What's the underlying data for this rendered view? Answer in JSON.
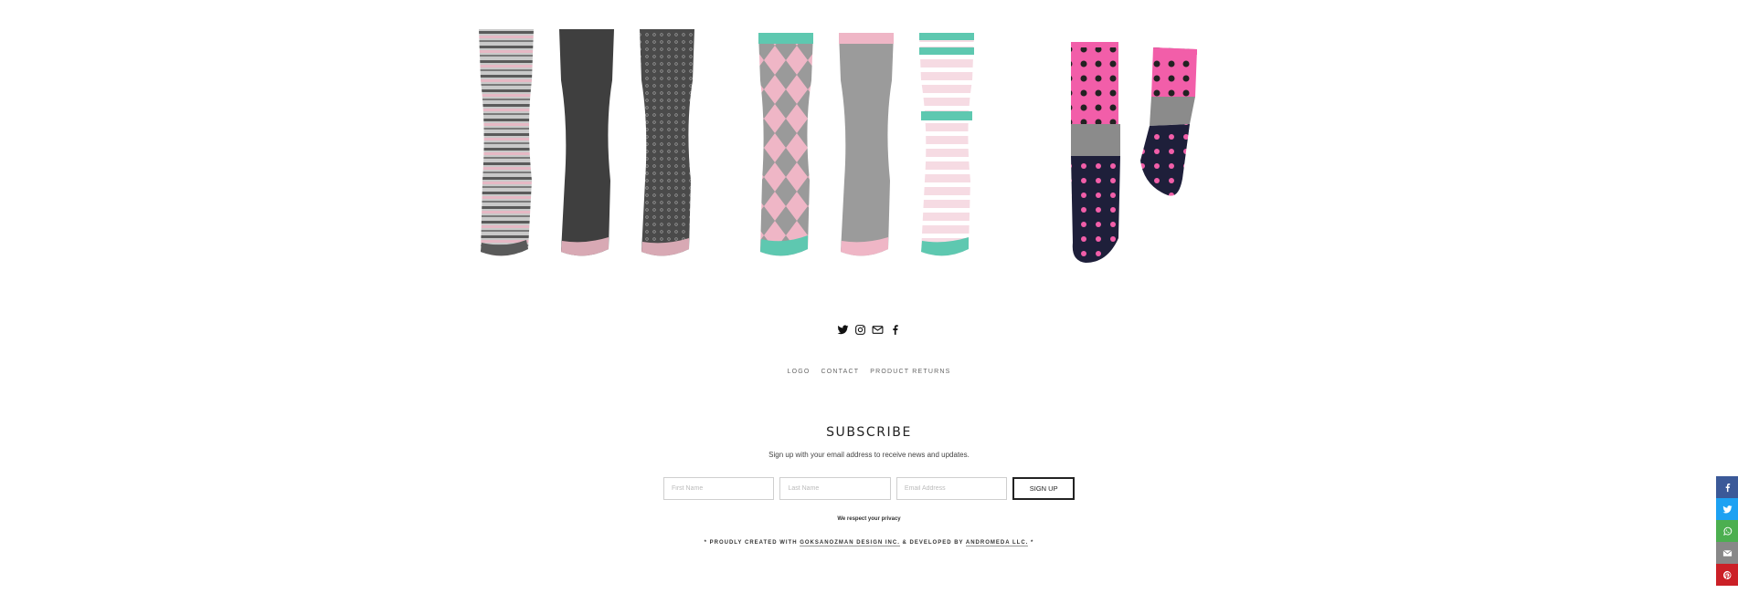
{
  "products": [
    {
      "name": "grey-pink-sock-trio"
    },
    {
      "name": "pink-argyle-sock-trio"
    },
    {
      "name": "pink-polka-dot-socks"
    }
  ],
  "social_icons": [
    "twitter-icon",
    "instagram-icon",
    "email-icon",
    "facebook-icon"
  ],
  "footer_nav": [
    "LOGO",
    "CONTACT",
    "PRODUCT RETURNS"
  ],
  "subscribe": {
    "title": "SUBSCRIBE",
    "description": "Sign up with your email address to receive news and updates.",
    "first_name_placeholder": "First Name",
    "last_name_placeholder": "Last Name",
    "email_placeholder": "Email Address",
    "button_label": "SIGN UP",
    "privacy": "We respect your privacy"
  },
  "credits": {
    "prefix": "* PROUDLY CREATED WITH ",
    "design": "GOKSANOZMAN DESIGN INC.",
    "middle": " & DEVELOPED BY ",
    "developer": "ANDROMEDA LLC.",
    "suffix": " *"
  },
  "share_bar": [
    {
      "icon": "facebook-icon",
      "color": "#3b5998"
    },
    {
      "icon": "twitter-icon",
      "color": "#1da1f2"
    },
    {
      "icon": "whatsapp-icon",
      "color": "#4caf50"
    },
    {
      "icon": "email-icon",
      "color": "#888888"
    },
    {
      "icon": "pinterest-icon",
      "color": "#cb2027"
    }
  ]
}
